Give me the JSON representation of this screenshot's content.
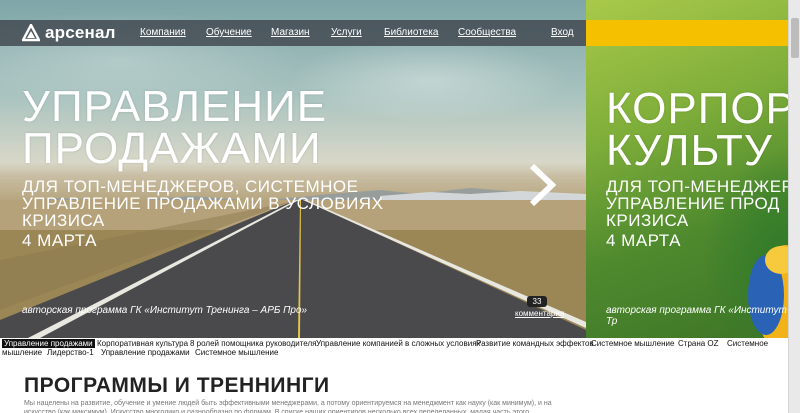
{
  "header": {
    "logo_text": "арсенал",
    "nav": [
      "Компания",
      "Обучение",
      "Магазин",
      "Услуги",
      "Библиотека",
      "Сообщества"
    ],
    "login_label": "Вход"
  },
  "slides": [
    {
      "title_line1": "УПРАВЛЕНИЕ",
      "title_line2": "ПРОДАЖАМИ",
      "subtitle_line1": "ДЛЯ ТОП-МЕНЕДЖЕРОВ, СИСТЕМНОЕ",
      "subtitle_line2": "УПРАВЛЕНИЕ ПРОДАЖАМИ В УСЛОВИЯХ",
      "subtitle_line3": "КРИЗИСА",
      "date": "4 МАРТА",
      "author": "авторская программа ГК «Институт Тренинга – АРБ Про»",
      "comments_count": "33",
      "comments_label": "комментария"
    },
    {
      "title_line1": "КОРПОР",
      "title_line2": "КУЛЬТУ",
      "subtitle_line1": "ДЛЯ ТОП-МЕНЕДЖЕР",
      "subtitle_line2": "УПРАВЛЕНИЕ ПРОД",
      "subtitle_line3": "КРИЗИСА",
      "date": "4 МАРТА",
      "author": "авторская программа ГК «Институт Тр"
    }
  ],
  "tags": [
    "Управление продажами",
    "Корпоративная культура",
    "8 ролей помощника руководителя",
    "Управление компанией в сложных условиях",
    "Развитие командных эффектов",
    "Системное мышление",
    "Страна OZ",
    "Системное",
    "мышление",
    "Лидерство-1",
    "Управление продажами",
    "Системное мышление"
  ],
  "content": {
    "title": "ПРОГРАММЫ И ТРЕННИНГИ",
    "text": "Мы нацелены на развитие, обучение и умение людей быть эффективными менеджерами, а потому ориентируемся на менеджмент как науку (как минимум), и на искусство (как максимум). Искусство многолико и разнообразно по формам. В списке наших ориентиров несколько всех переделанных, малая часть этого"
  },
  "colors": {
    "topbar": "#40464e",
    "accent_yellow": "#f5c000",
    "active_tag_bg": "#111111"
  }
}
